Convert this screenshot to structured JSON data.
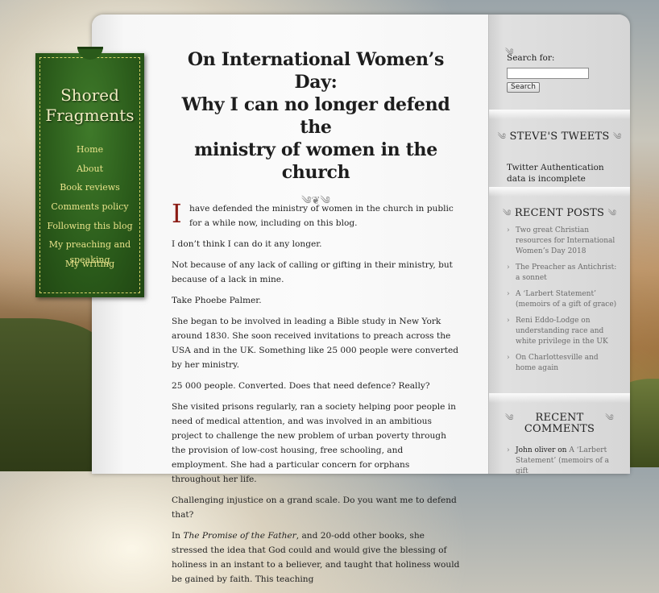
{
  "site": {
    "title_line1": "Shored",
    "title_line2": "Fragments"
  },
  "nav": {
    "items": [
      {
        "label": "Home"
      },
      {
        "label": "About"
      },
      {
        "label": "Book reviews"
      },
      {
        "label": "Comments policy"
      },
      {
        "label": "Following this blog"
      },
      {
        "label": "My preaching and speaking"
      },
      {
        "label": "My writing"
      }
    ]
  },
  "post": {
    "title_line1": "On International Women’s Day:",
    "title_line2": "Why I can no longer defend the",
    "title_line3": "ministry of women in the church",
    "ornament": "༄❦༄",
    "dropcap": "I",
    "p1": "have defended the ministry of women in the church in public for a while now, including on this blog.",
    "p2": "I don’t think I can do it any longer.",
    "p3": "Not because of any lack of calling or gifting in their ministry, but because of a lack in mine.",
    "p4": "Take Phoebe Palmer.",
    "p5": "She began to be involved in leading a Bible study in New York around 1830. She soon received invitations to preach across the USA and in the UK. Something like 25 000 people were converted by her ministry.",
    "p6": "25 000 people. Converted. Does that need defence? Really?",
    "p7": "She visited prisons regularly, ran a society helping poor people in need of medical attention, and was involved in an ambitious project to challenge the new problem of urban poverty through the provision of low-cost housing, free schooling, and employment. She had a particular concern for orphans throughout her life.",
    "p8": "Challenging injustice on a grand scale. Do you want me to defend that?",
    "p9_pre": "In ",
    "p9_italic": "The Promise of the Father",
    "p9_post": ", and 20-odd other books, she stressed the idea that God could and would give the blessing of holiness in an instant to a believer, and taught that holiness would be gained by faith. This teaching"
  },
  "sidebar": {
    "search": {
      "label": "Search for:",
      "value": "",
      "button": "Search"
    },
    "tweets": {
      "title": "STEVE'S TWEETS",
      "message": "Twitter Authentication data is incomplete"
    },
    "recent_posts": {
      "title": "RECENT POSTS",
      "items": [
        {
          "label": "Two great Christian resources for International Women’s Day 2018"
        },
        {
          "label": "The Preacher as Antichrist: a sonnet"
        },
        {
          "label": "A ‘Larbert Statement’ (memoirs of a gift of grace)"
        },
        {
          "label": "Reni Eddo-Lodge on understanding race and white privilege in the UK"
        },
        {
          "label": "On Charlottesville and home again"
        }
      ]
    },
    "recent_comments": {
      "title_line1": "RECENT",
      "title_line2": "COMMENTS",
      "items": [
        {
          "author": "John oliver",
          "on": " on ",
          "post": "A ‘Larbert Statement’ (memoirs of a gift"
        }
      ]
    }
  }
}
